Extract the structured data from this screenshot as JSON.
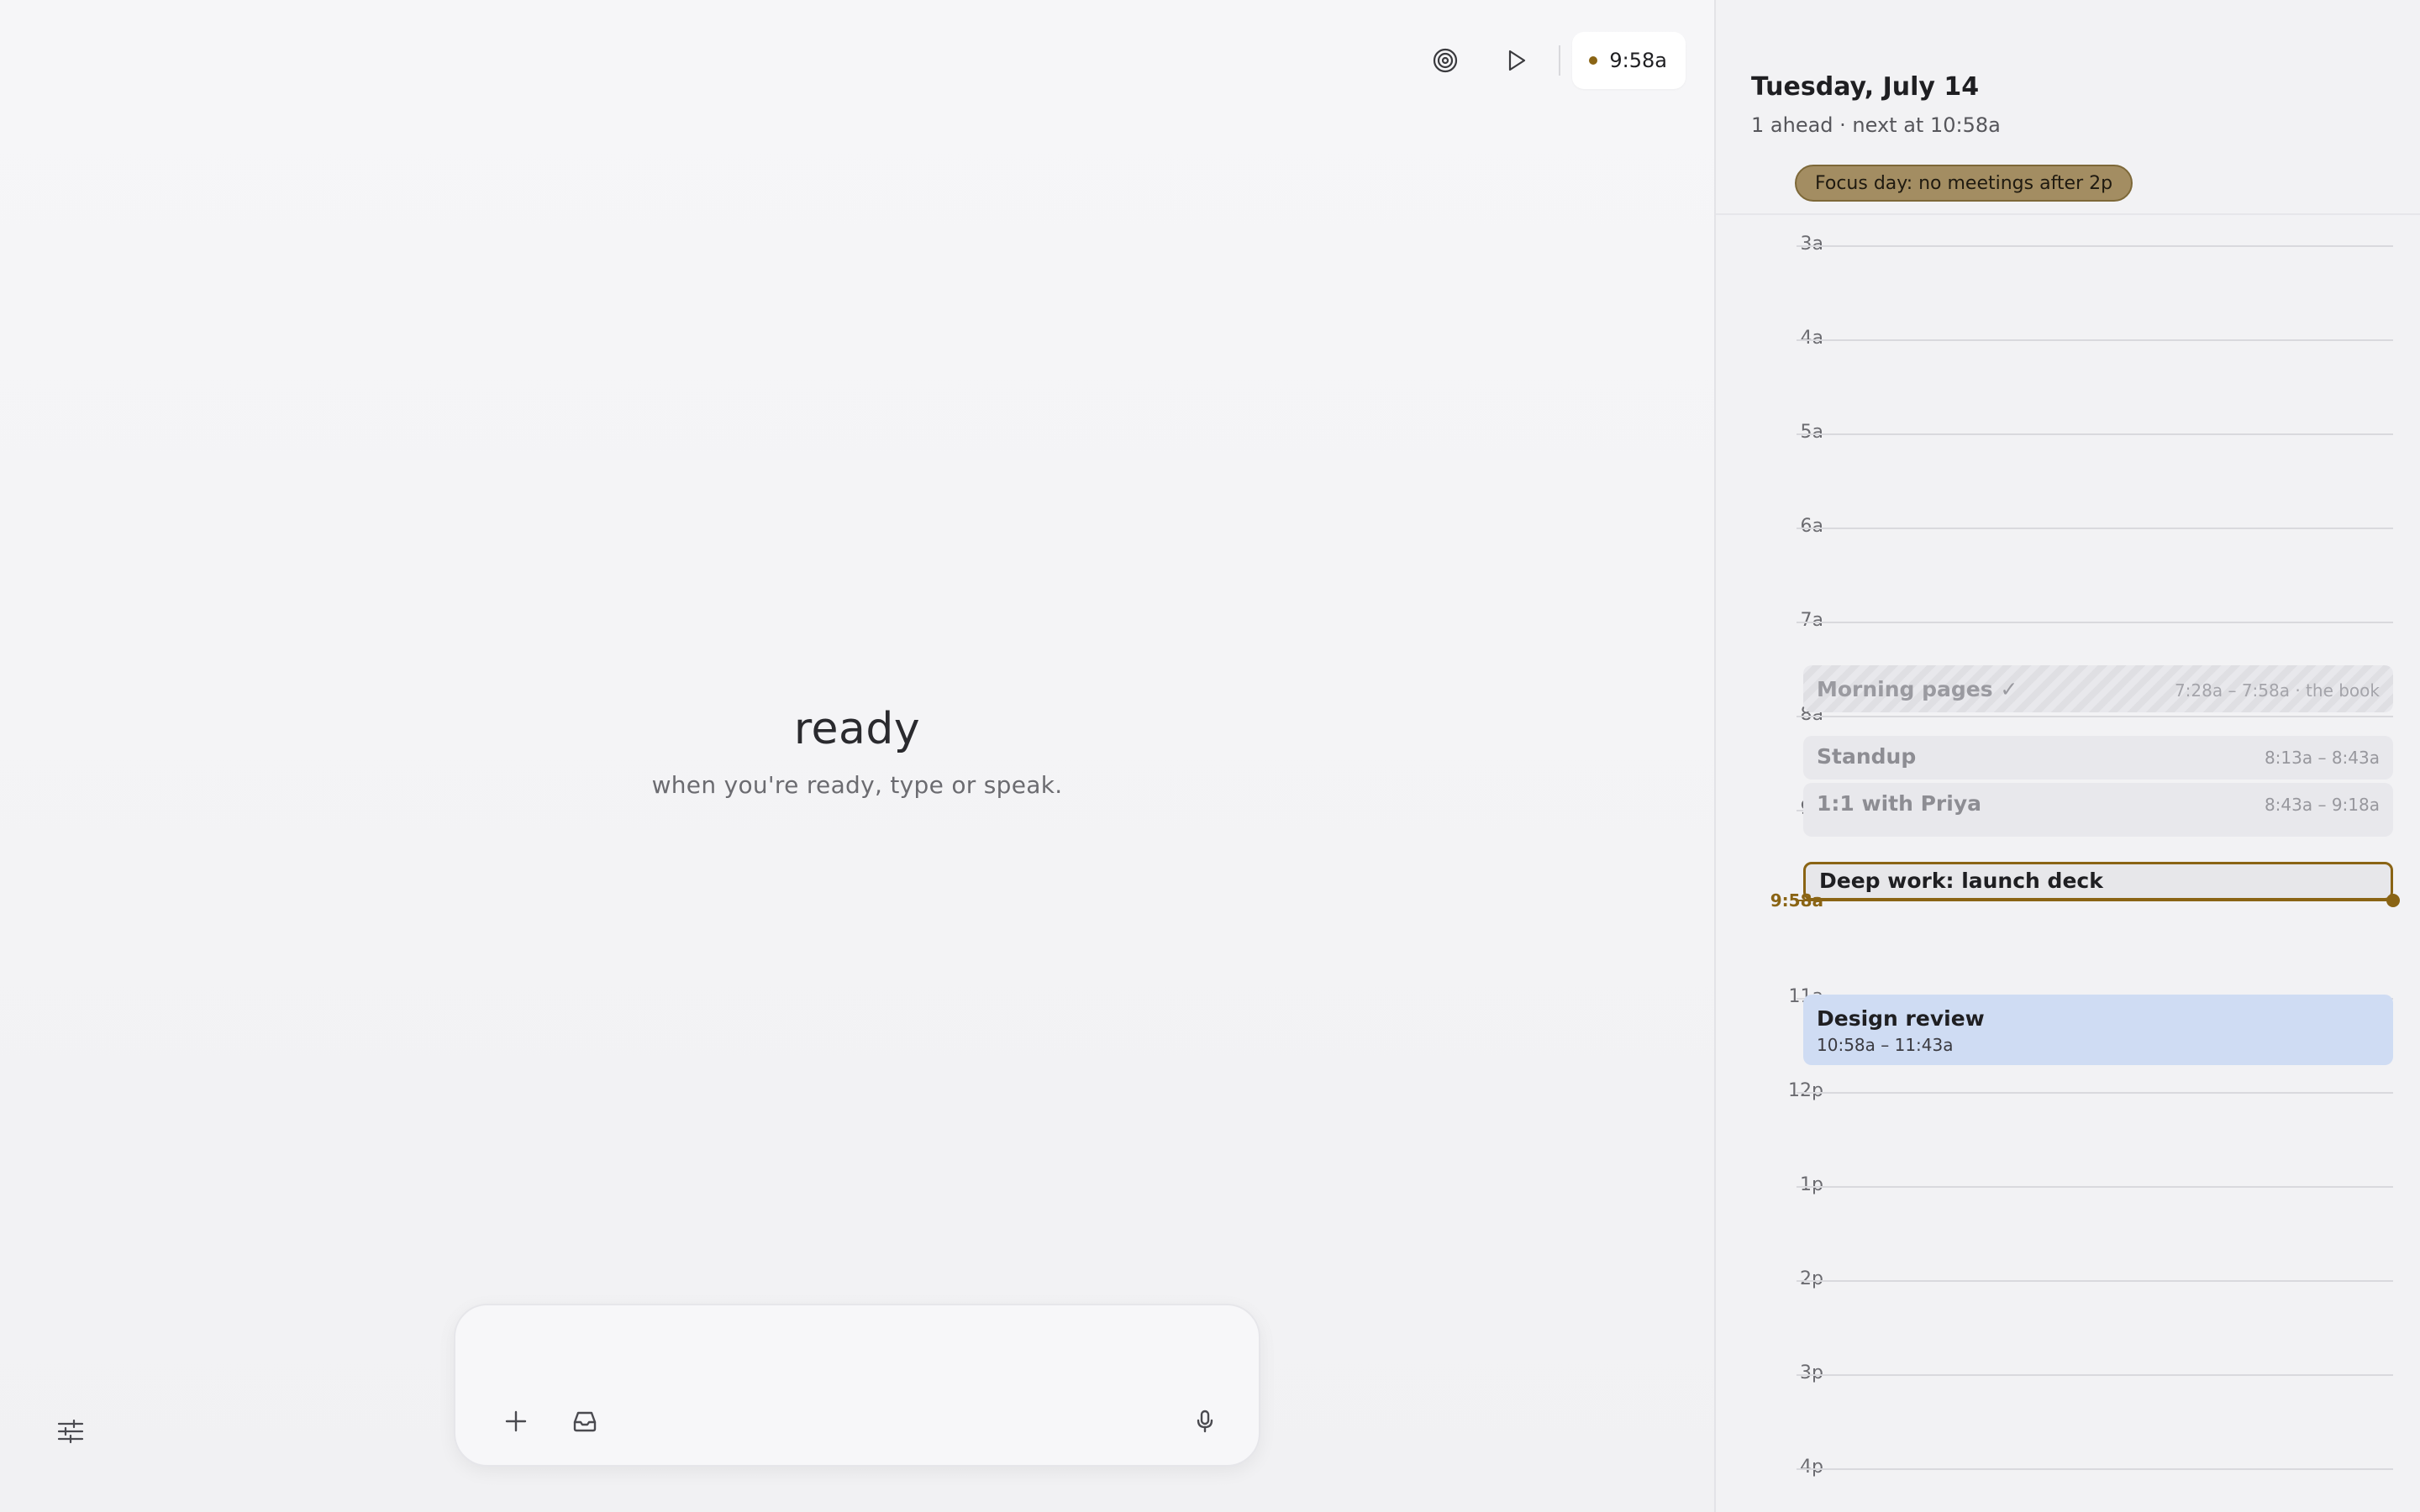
{
  "toolbar": {
    "focus_icon": "target-icon",
    "play_icon": "play-icon",
    "clock_time": "9:58a",
    "accent": "#8a6414"
  },
  "main": {
    "title": "ready",
    "subtitle": "when you're ready, type or speak."
  },
  "composer": {
    "placeholder": "",
    "value": "",
    "add_icon": "plus-icon",
    "inbox_icon": "inbox-icon",
    "mic_icon": "microphone-icon"
  },
  "settings_icon": "sliders-icon",
  "calendar": {
    "date": "Tuesday, July 14",
    "summary": "1 ahead · next at 10:58a",
    "focus_chip": "Focus day: no meetings after 2p",
    "hours": [
      "3a",
      "4a",
      "5a",
      "6a",
      "7a",
      "8a",
      "9a",
      "10a",
      "11a",
      "12p",
      "1p",
      "2p",
      "3p",
      "4p"
    ],
    "now_label": "9:58a",
    "events": [
      {
        "title": "Morning pages ✓",
        "time": "7:28a – 7:58a · the book",
        "status": "done"
      },
      {
        "title": "Standup",
        "time": "8:13a – 8:43a",
        "status": "past"
      },
      {
        "title": "1:1 with Priya",
        "time": "8:43a – 9:18a",
        "status": "past"
      },
      {
        "title": "Deep work: launch deck",
        "time": "",
        "status": "current"
      },
      {
        "title": "Design review",
        "time": "10:58a – 11:43a",
        "status": "next"
      }
    ],
    "colors": {
      "current_border": "#8a6414",
      "next_bg": "#cfdcf3",
      "focus_chip_bg": "#a38d62"
    }
  }
}
